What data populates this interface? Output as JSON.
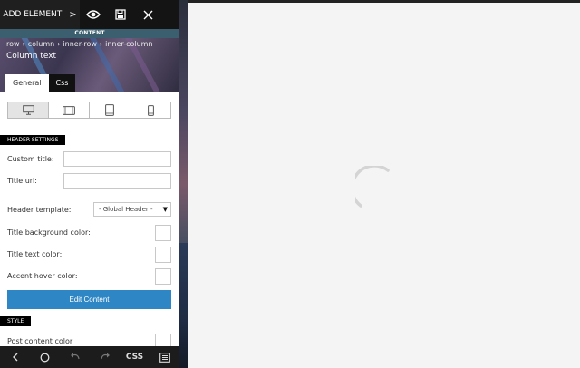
{
  "toolbar": {
    "add_element_label": "ADD ELEMENT",
    "chevron_glyph": ">",
    "icons": [
      "eye-icon",
      "save-icon",
      "close-icon"
    ]
  },
  "content_label": "CONTENT",
  "breadcrumb": [
    "row",
    "column",
    "inner-row",
    "inner-column"
  ],
  "element_title": "Column text",
  "tabs": [
    {
      "label": "General",
      "active": true
    },
    {
      "label": "Css",
      "active": false
    }
  ],
  "devices": [
    "desktop-icon",
    "tablet-landscape-icon",
    "tablet-portrait-icon",
    "mobile-icon"
  ],
  "header_settings": {
    "section_label": "HEADER SETTINGS",
    "custom_title_label": "Custom title:",
    "custom_title_value": "",
    "title_url_label": "Title url:",
    "title_url_value": "",
    "header_template_label": "Header template:",
    "header_template_value": "- Global Header -",
    "title_bg_color_label": "Title background color:",
    "title_text_color_label": "Title text color:",
    "accent_hover_color_label": "Accent hover color:"
  },
  "edit_content_label": "Edit Content",
  "style": {
    "section_label": "STYLE",
    "post_content_color_label": "Post content color"
  },
  "bottom_bar": {
    "css_label": "CSS",
    "icons": [
      "back-icon",
      "home-circle-icon",
      "undo-icon",
      "redo-icon",
      "css-button",
      "layers-icon"
    ]
  },
  "colors": {
    "accent_blue": "#2e86c4",
    "toolbar_bg": "#141414",
    "content_band": "#3b5f6f",
    "preview_bg": "#f4f4f4"
  }
}
